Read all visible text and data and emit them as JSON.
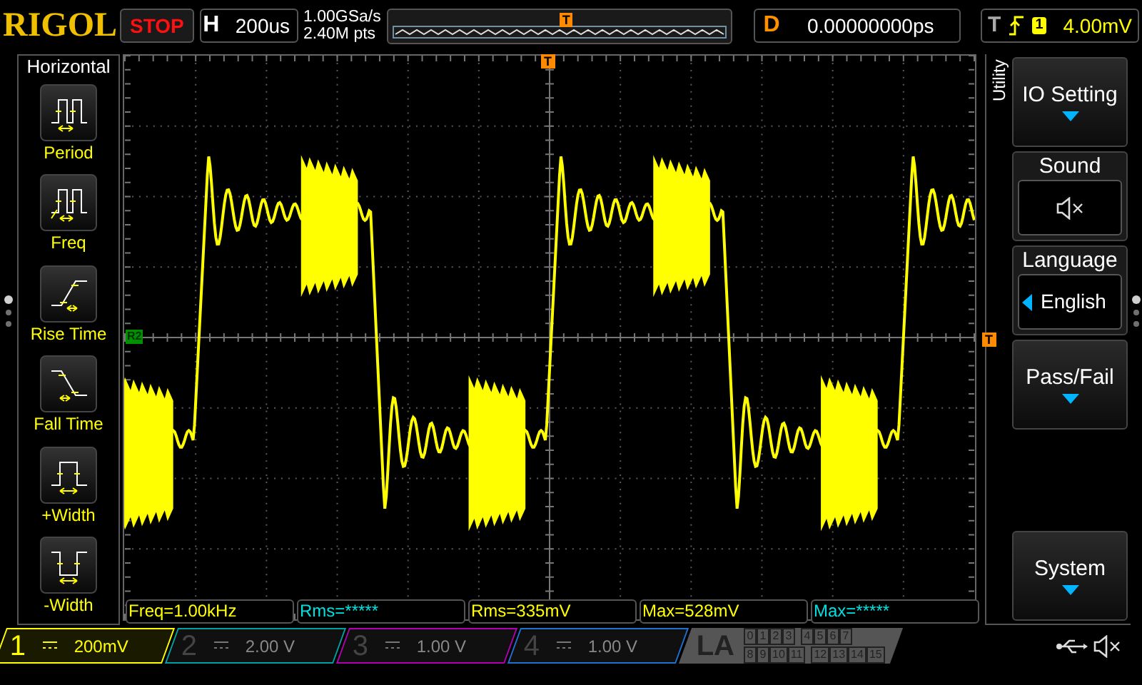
{
  "logo": "RIGOL",
  "run_state": {
    "label": "STOP",
    "running": false
  },
  "timebase": {
    "label": "H",
    "value": "200us"
  },
  "acquisition": {
    "sample_rate": "1.00GSa/s",
    "memory_depth": "2.40M pts"
  },
  "memory_bar": {
    "trigger_marker": "T"
  },
  "delay": {
    "label": "D",
    "value": "0.00000000ps"
  },
  "trigger": {
    "label": "T",
    "source": "1",
    "level_reading": "4.00mV"
  },
  "left_menu": {
    "title": "Horizontal",
    "items": [
      {
        "kind": "period",
        "label": "Period"
      },
      {
        "kind": "freq",
        "label": "Freq"
      },
      {
        "kind": "rise",
        "label": "Rise Time"
      },
      {
        "kind": "fall",
        "label": "Fall Time"
      },
      {
        "kind": "pwidth",
        "label": "+Width"
      },
      {
        "kind": "nwidth",
        "label": "-Width"
      }
    ],
    "page_dots": [
      {
        "selected": true
      },
      {
        "selected": false
      },
      {
        "selected": false
      }
    ]
  },
  "graticule": {
    "ref_marker": "R2",
    "trigger_top_marker": "T",
    "trigger_level_marker": "T"
  },
  "measurements": [
    {
      "text": "Freq=1.00kHz",
      "color": "#ffff00"
    },
    {
      "text": "Rms=*****",
      "color": "#00e0e0"
    },
    {
      "text": "Rms=335mV",
      "color": "#ffff00"
    },
    {
      "text": "Max=528mV",
      "color": "#ffff00"
    },
    {
      "text": "Max=*****",
      "color": "#00e0e0"
    }
  ],
  "channels": [
    {
      "number": "1",
      "scale": "200mV",
      "on": true,
      "color": "#ffff00"
    },
    {
      "number": "2",
      "scale": "2.00 V",
      "on": false,
      "color": "#00a0a0"
    },
    {
      "number": "3",
      "scale": "1.00 V",
      "on": false,
      "color": "#b000b0"
    },
    {
      "number": "4",
      "scale": "1.00 V",
      "on": false,
      "color": "#2070d0"
    }
  ],
  "logic_analyzer": {
    "label": "LA",
    "channel_rows": [
      [
        "0",
        "1",
        "2",
        "3",
        "4",
        "5",
        "6",
        "7"
      ],
      [
        "8",
        "9",
        "10",
        "11",
        "12",
        "13",
        "14",
        "15"
      ]
    ]
  },
  "right_menu": {
    "title": "Utility",
    "items": [
      {
        "kind": "submenu",
        "label": "IO Setting"
      },
      {
        "kind": "toggle",
        "label": "Sound",
        "on": false
      },
      {
        "kind": "choice",
        "label": "Language",
        "value": "English"
      },
      {
        "kind": "submenu",
        "label": "Pass/Fail"
      },
      {
        "kind": "empty"
      },
      {
        "kind": "submenu",
        "label": "System"
      }
    ],
    "page_dots": [
      {
        "selected": true
      },
      {
        "selected": false
      },
      {
        "selected": false
      }
    ]
  },
  "status": {
    "usb_connected": true,
    "sound_on": false
  }
}
